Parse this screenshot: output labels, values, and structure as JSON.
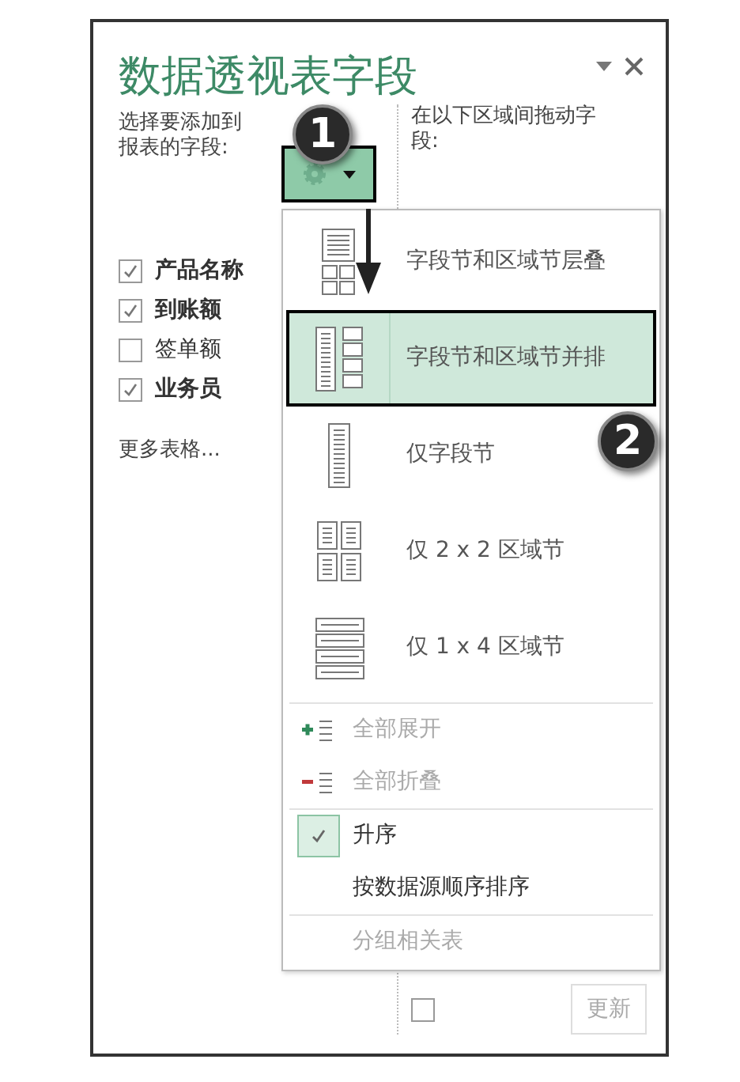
{
  "panel": {
    "title": "数据透视表字段",
    "left_prompt": "选择要添加到报表的字段:",
    "right_prompt": "在以下区域间拖动字段:",
    "fields": [
      {
        "label": "产品名称",
        "checked": true
      },
      {
        "label": "到账额",
        "checked": true
      },
      {
        "label": "签单额",
        "checked": false
      },
      {
        "label": "业务员",
        "checked": true
      }
    ],
    "more_tables": "更多表格...",
    "defer_update": {
      "checked": false
    },
    "update_button": {
      "label": "更新",
      "disabled": true
    }
  },
  "menu": {
    "layouts": [
      {
        "label": "字段节和区域节层叠",
        "kind": "stacked",
        "selected": false
      },
      {
        "label": "字段节和区域节并排",
        "kind": "side",
        "selected": true
      },
      {
        "label": "仅字段节",
        "kind": "fields",
        "selected": false
      },
      {
        "label": "仅 2 x 2 区域节",
        "kind": "grid",
        "selected": false
      },
      {
        "label": "仅 1 x 4 区域节",
        "kind": "rows",
        "selected": false
      }
    ],
    "actions": [
      {
        "label": "全部展开",
        "kind": "expand",
        "disabled": true
      },
      {
        "label": "全部折叠",
        "kind": "collapse",
        "disabled": true
      }
    ],
    "sort": [
      {
        "label": "升序",
        "selected": true
      },
      {
        "label": "按数据源顺序排序",
        "selected": false
      }
    ],
    "group": {
      "label": "分组相关表",
      "disabled": true
    }
  },
  "callouts": [
    "1",
    "2"
  ]
}
